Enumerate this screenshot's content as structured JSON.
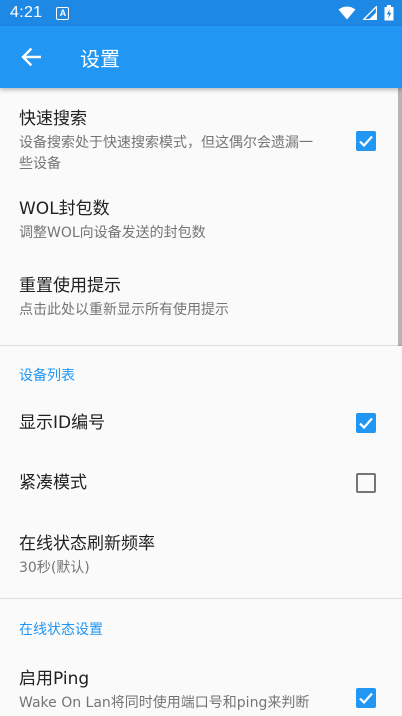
{
  "status_bar": {
    "time": "4:21",
    "notification_letter": "A"
  },
  "app_bar": {
    "title": "设置"
  },
  "preferences": [
    {
      "title": "快速搜索",
      "summary": "设备搜索处于快速搜索模式，但这偶尔会遗漏一些设备",
      "checked": true
    },
    {
      "title": "WOL封包数",
      "summary": "调整WOL向设备发送的封包数"
    },
    {
      "title": "重置使用提示",
      "summary": "点击此处以重新显示所有使用提示"
    }
  ],
  "categories": {
    "device_list": {
      "label": "设备列表",
      "items": [
        {
          "title": "显示ID编号",
          "checked": true
        },
        {
          "title": "紧凑模式",
          "checked": false
        },
        {
          "title": "在线状态刷新频率",
          "summary": "30秒(默认)"
        }
      ]
    },
    "online_status": {
      "label": "在线状态设置",
      "items": [
        {
          "title": "启用Ping",
          "summary": "Wake On Lan将同时使用端口号和ping来判断",
          "checked": true
        }
      ]
    }
  },
  "colors": {
    "accent": "#2196f3",
    "status_bar": "#1e88e5",
    "app_bar": "#2196f3"
  }
}
